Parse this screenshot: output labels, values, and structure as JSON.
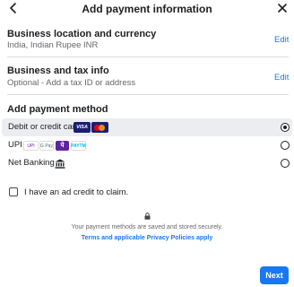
{
  "header": {
    "title": "Add payment information",
    "back_icon": "arrow-left-icon",
    "close_icon": "close-icon"
  },
  "business_location": {
    "title": "Business location and currency",
    "value": "India, Indian Rupee INR",
    "edit_label": "Edit"
  },
  "business_tax": {
    "title": "Business and tax info",
    "value": "Optional - Add a tax ID or address",
    "edit_label": "Edit"
  },
  "payment_method": {
    "title": "Add payment method",
    "options": [
      {
        "label": "Debit or credit card",
        "selected": true,
        "badges": [
          "VISA",
          "mastercard"
        ]
      },
      {
        "label": "UPI",
        "selected": false,
        "badges": [
          "UPI",
          "G Pay",
          "पे",
          "PAYTM"
        ]
      },
      {
        "label": "Net Banking",
        "selected": false,
        "badges": [
          "bank-icon"
        ]
      }
    ]
  },
  "ad_credit": {
    "label": "I have an ad credit to claim.",
    "checked": false
  },
  "footer": {
    "secure_text": "Your payment methods are saved and stored securely.",
    "terms_link": "Terms and applicable Privacy Policies apply",
    "lock_icon": "lock-icon",
    "next_label": "Next"
  },
  "colors": {
    "accent": "#1877f2",
    "selected_row_bg": "#ebedf0",
    "text_primary": "#1c1e21",
    "text_secondary": "#65676b",
    "divider": "#dadde1"
  }
}
